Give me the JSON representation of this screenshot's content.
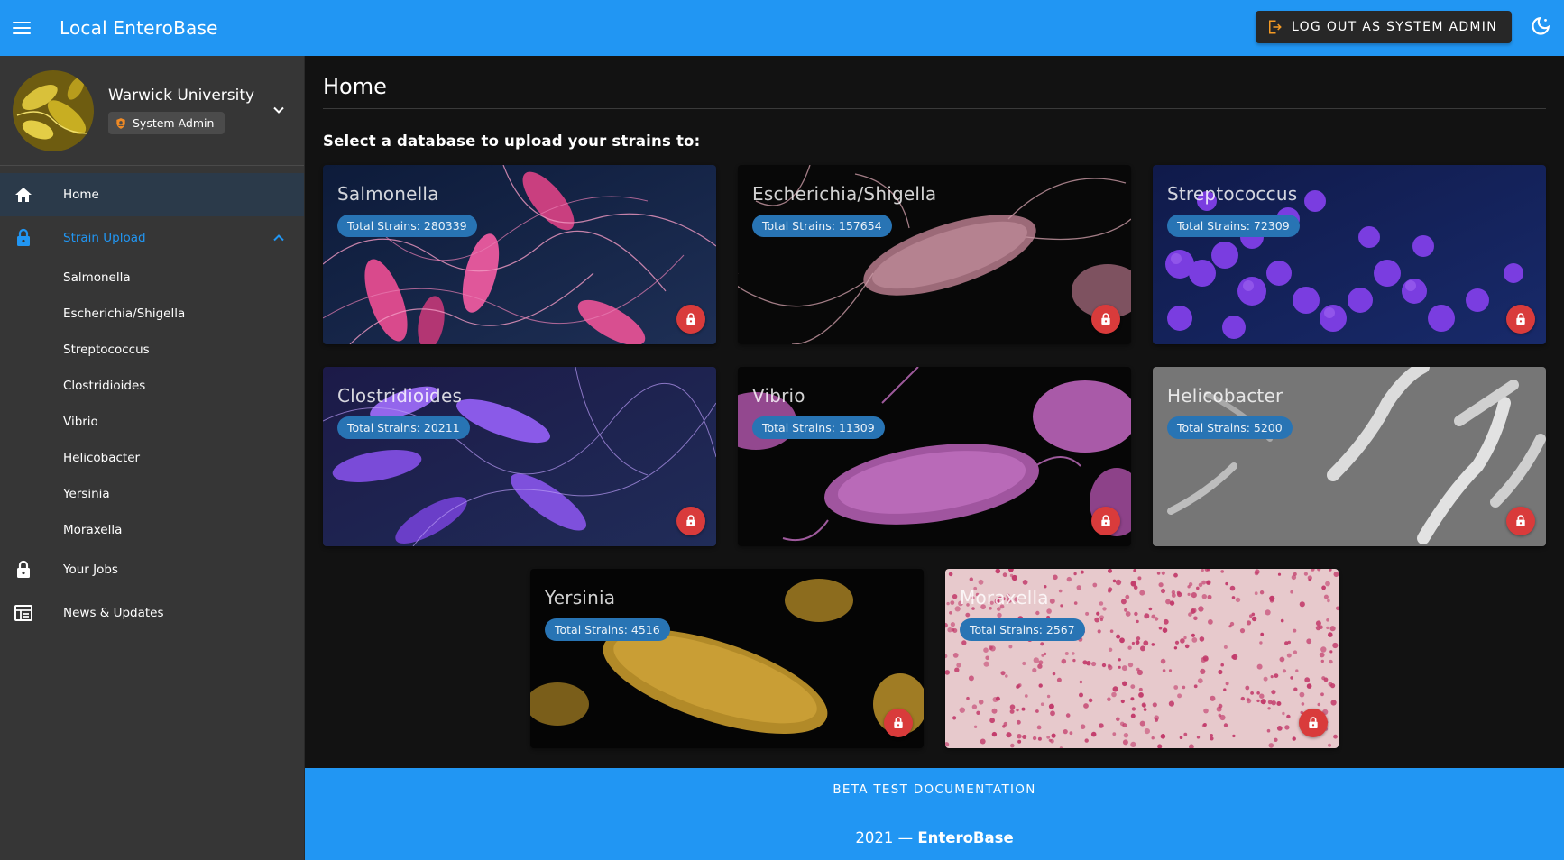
{
  "app": {
    "title": "Local EnteroBase",
    "logout_label": "Log out as System Admin"
  },
  "profile": {
    "org_name": "Warwick University",
    "role": "System Admin"
  },
  "nav": {
    "home": "Home",
    "strain_upload": "Strain Upload",
    "sub_items": [
      "Salmonella",
      "Escherichia/Shigella",
      "Streptococcus",
      "Clostridioides",
      "Vibrio",
      "Helicobacter",
      "Yersinia",
      "Moraxella"
    ],
    "your_jobs": "Your Jobs",
    "news": "News & Updates"
  },
  "main": {
    "title": "Home",
    "subtitle": "Select a database to upload your strains to:",
    "databases": [
      {
        "name": "Salmonella",
        "strains": "Total Strains: 280339"
      },
      {
        "name": "Escherichia/Shigella",
        "strains": "Total Strains: 157654"
      },
      {
        "name": "Streptococcus",
        "strains": "Total Strains: 72309"
      },
      {
        "name": "Clostridioides",
        "strains": "Total Strains: 20211"
      },
      {
        "name": "Vibrio",
        "strains": "Total Strains: 11309"
      },
      {
        "name": "Helicobacter",
        "strains": "Total Strains: 5200"
      },
      {
        "name": "Yersinia",
        "strains": "Total Strains: 4516"
      },
      {
        "name": "Moraxella",
        "strains": "Total Strains: 2567"
      }
    ]
  },
  "footer": {
    "doc_link": "BETA TEST DOCUMENTATION",
    "year": "2021 —",
    "brand": "EnteroBase"
  },
  "icons": {
    "menu": "menu-icon",
    "logout": "logout-icon",
    "theme": "dark-mode-icon",
    "home": "home-icon",
    "lock": "lock-icon",
    "news": "newspaper-icon",
    "chevron": "chevron-icon",
    "shield": "shield-icon"
  },
  "colors": {
    "primary": "#2196f3",
    "chip": "#2874b4",
    "lock": "#d93b3b",
    "sidebar": "#363636",
    "background": "#121212"
  }
}
